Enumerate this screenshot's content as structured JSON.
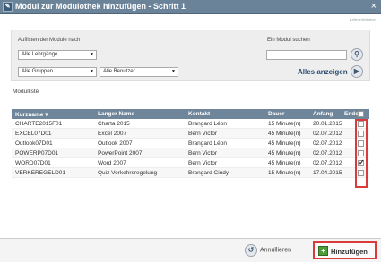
{
  "window": {
    "title": "Modul zur Modulothek hinzufügen - Schritt 1",
    "app_icon": "app-icon",
    "close_glyph": "×"
  },
  "user_tag": "Administrator",
  "filters": {
    "list_label": "Auflisten der Module nach",
    "learning_paths": "Alle Lehrgänge",
    "groups": "Alle Gruppen",
    "users": "Alle Benutzer",
    "search_label": "Ein Modul suchen",
    "show_all": "Alles anzeigen",
    "search_placeholder": ""
  },
  "section_title": "Modulliste",
  "table": {
    "headers": [
      "Kurzname",
      "Langer Name",
      "Kontakt",
      "Dauer",
      "Anfang",
      "Ende"
    ],
    "rows": [
      {
        "short": "CHARTE2015F01",
        "long": "Charta 2015",
        "contact": "Brangard Léon",
        "duration": "15 Minute(n)",
        "start": "20.01.2015",
        "end": "",
        "checked": false
      },
      {
        "short": "EXCEL07D01",
        "long": "Excel 2007",
        "contact": "Bern Victor",
        "duration": "45 Minute(n)",
        "start": "02.07.2012",
        "end": "",
        "checked": false
      },
      {
        "short": "Outlook07D01",
        "long": "Outlook 2007",
        "contact": "Brangard Léon",
        "duration": "45 Minute(n)",
        "start": "02.07.2012",
        "end": "",
        "checked": false
      },
      {
        "short": "POWERP07D01",
        "long": "PowerPoint 2007",
        "contact": "Bern Victor",
        "duration": "45 Minute(n)",
        "start": "02.07.2012",
        "end": "",
        "checked": false
      },
      {
        "short": "WORD07D01",
        "long": "Word 2007",
        "contact": "Bern Victor",
        "duration": "45 Minute(n)",
        "start": "02.07.2012",
        "end": "",
        "checked": true
      },
      {
        "short": "VERKEREGELD01",
        "long": "Quiz Verkehrsregelung",
        "contact": "Brangard Cindy",
        "duration": "15 Minute(n)",
        "start": "17.04.2015",
        "end": "",
        "checked": false
      }
    ]
  },
  "footer": {
    "cancel": "Annullieren",
    "add": "Hinzufügen"
  },
  "colors": {
    "titlebar": "#6b8398",
    "header": "#6f8599",
    "highlight": "#d93b3b",
    "add_icon": "#4f9a3d"
  }
}
